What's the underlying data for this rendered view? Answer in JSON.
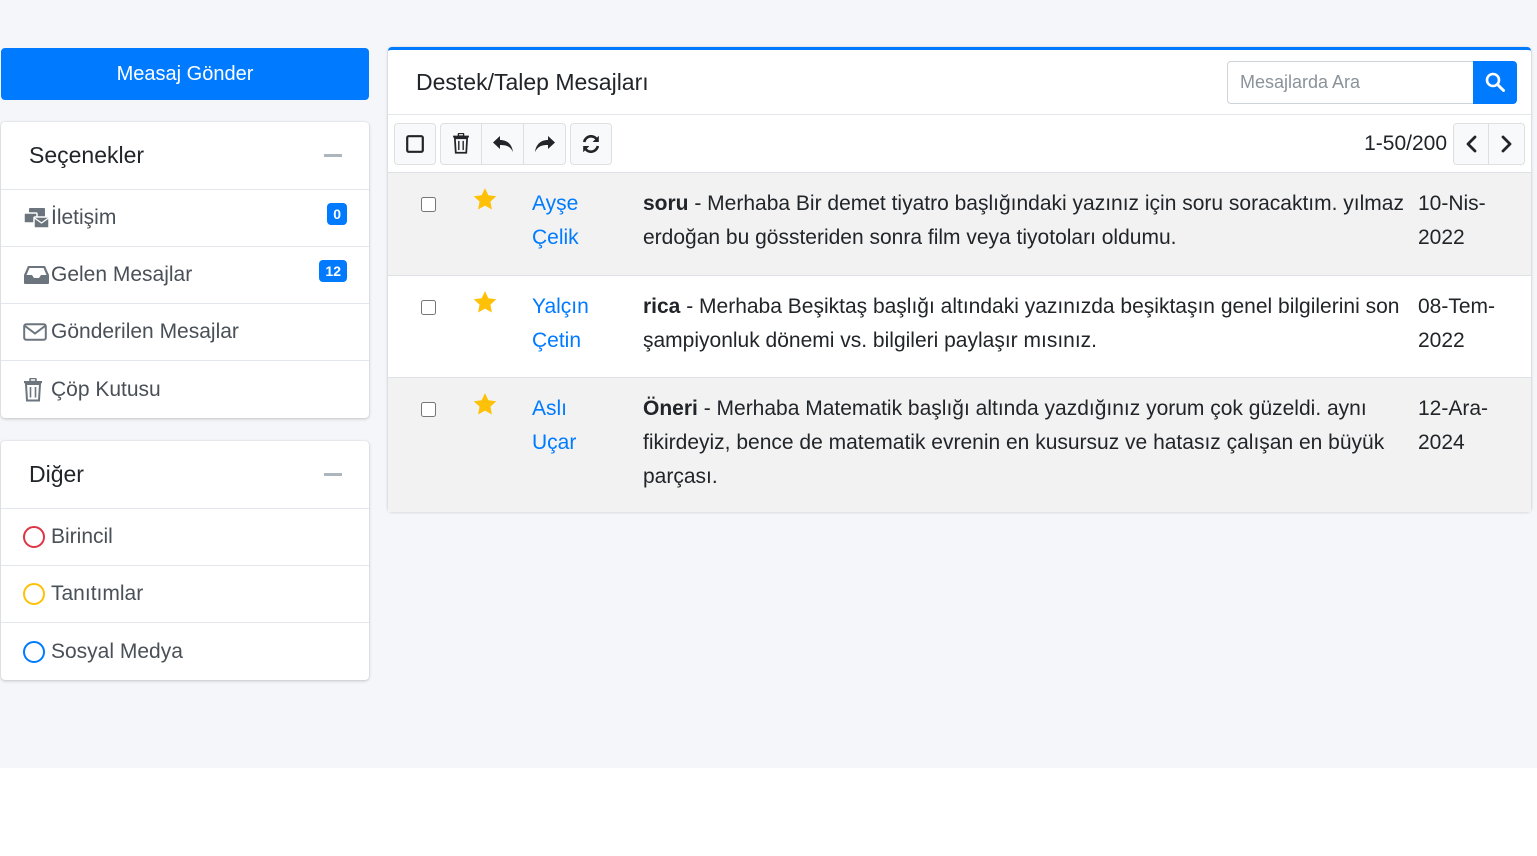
{
  "sidebar": {
    "compose_label": "Measaj Gönder",
    "options": {
      "title": "Seçenekler",
      "items": [
        {
          "label": "İletişim",
          "icon": "mail-bulk-icon",
          "badge": "0"
        },
        {
          "label": "Gelen Mesajlar",
          "icon": "inbox-icon",
          "badge": "12"
        },
        {
          "label": "Gönderilen Mesajlar",
          "icon": "envelope-icon"
        },
        {
          "label": "Çöp Kutusu",
          "icon": "trash-icon"
        }
      ]
    },
    "other": {
      "title": "Diğer",
      "items": [
        {
          "label": "Birincil",
          "color": "#dc3545"
        },
        {
          "label": "Tanıtımlar",
          "color": "#ffc107"
        },
        {
          "label": "Sosyal Medya",
          "color": "#007bff"
        }
      ]
    }
  },
  "main": {
    "title": "Destek/Talep Mesajları",
    "search_placeholder": "Mesajlarda Ara",
    "pagination": "1-50/200",
    "messages": [
      {
        "first_name": "Ayşe",
        "last_name": "Çelik",
        "subject": "soru",
        "body": " - Merhaba Bir demet tiyatro başlığındaki yazınız için soru soracaktım. yılmaz erdoğan bu gössteriden sonra film veya tiyotoları oldumu.",
        "date_line1": "10-Nis-",
        "date_line2": "2022",
        "starred": true
      },
      {
        "first_name": "Yalçın",
        "last_name": "Çetin",
        "subject": "rica",
        "body": " - Merhaba Beşiktaş başlığı altındaki yazınızda beşiktaşın genel bilgilerini son şampiyonluk dönemi vs. bilgileri paylaşır mısınız.",
        "date_line1": "08-Tem-",
        "date_line2": "2022",
        "starred": true
      },
      {
        "first_name": "Aslı",
        "last_name": "Uçar",
        "subject": "Öneri",
        "body": " - Merhaba Matematik başlığı altında yazdığınız yorum çok güzeldi. aynı fikirdeyiz, bence de matematik evrenin en kusursuz ve hatasız çalışan en büyük parçası.",
        "date_line1": "12-Ara-",
        "date_line2": "2024",
        "starred": true
      }
    ]
  },
  "colors": {
    "primary": "#007bff",
    "star": "#ffc107"
  }
}
